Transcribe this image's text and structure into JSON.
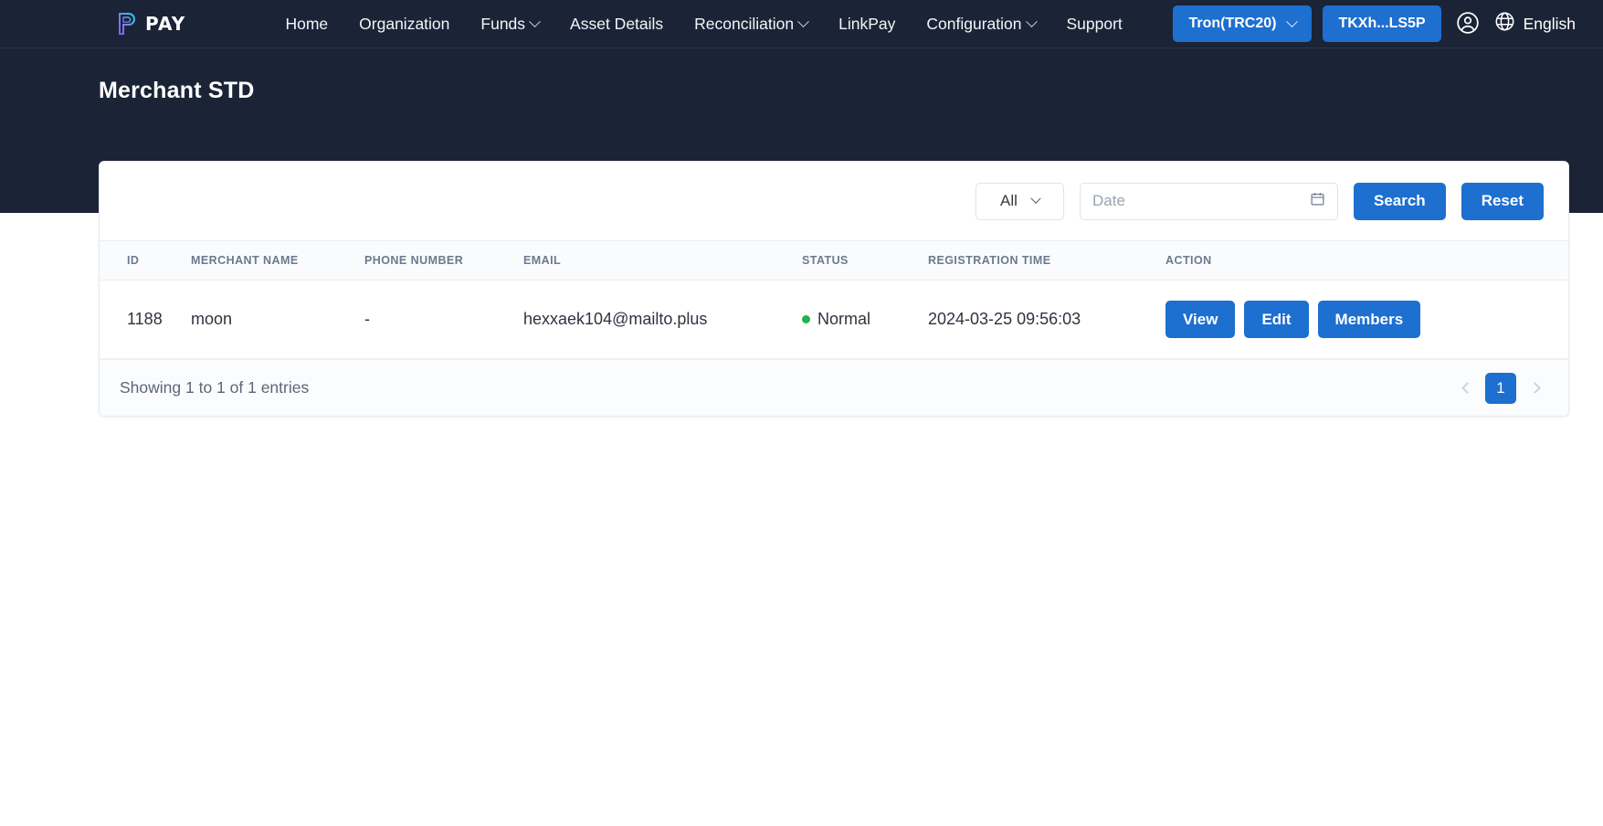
{
  "brand": {
    "text": "PAY",
    "logo_icon": "p-logo-icon"
  },
  "nav": {
    "items": [
      {
        "label": "Home",
        "has_caret": false
      },
      {
        "label": "Organization",
        "has_caret": false
      },
      {
        "label": "Funds",
        "has_caret": true
      },
      {
        "label": "Asset Details",
        "has_caret": false
      },
      {
        "label": "Reconciliation",
        "has_caret": true
      },
      {
        "label": "LinkPay",
        "has_caret": false
      },
      {
        "label": "Configuration",
        "has_caret": true
      },
      {
        "label": "Support",
        "has_caret": false
      }
    ],
    "network_button": "Tron(TRC20)",
    "wallet_button": "TKXh...LS5P",
    "account_icon": "user-circle-icon",
    "globe_icon": "globe-icon",
    "language": "English"
  },
  "header": {
    "title": "Merchant STD"
  },
  "toolbar": {
    "status_filter_value": "All",
    "date_placeholder": "Date",
    "date_value": "",
    "calendar_icon": "calendar-icon",
    "search_label": "Search",
    "reset_label": "Reset"
  },
  "table": {
    "columns": [
      "ID",
      "MERCHANT NAME",
      "PHONE NUMBER",
      "EMAIL",
      "STATUS",
      "REGISTRATION TIME",
      "ACTION"
    ],
    "rows": [
      {
        "id": "1188",
        "merchant_name": "moon",
        "phone_number": "-",
        "email": "hexxaek104@mailto.plus",
        "status": "Normal",
        "status_color": "#22b14c",
        "registration_time": "2024-03-25 09:56:03",
        "actions": [
          "View",
          "Edit",
          "Members"
        ]
      }
    ]
  },
  "footer": {
    "entries_text": "Showing 1 to 1 of 1 entries",
    "prev_icon": "chevron-left-icon",
    "next_icon": "chevron-right-icon",
    "current_page": "1"
  },
  "colors": {
    "navbar_bg": "#1b2436",
    "accent_blue": "#1d6fd0",
    "status_green": "#22b14c",
    "page_bg": "#ffffff"
  }
}
